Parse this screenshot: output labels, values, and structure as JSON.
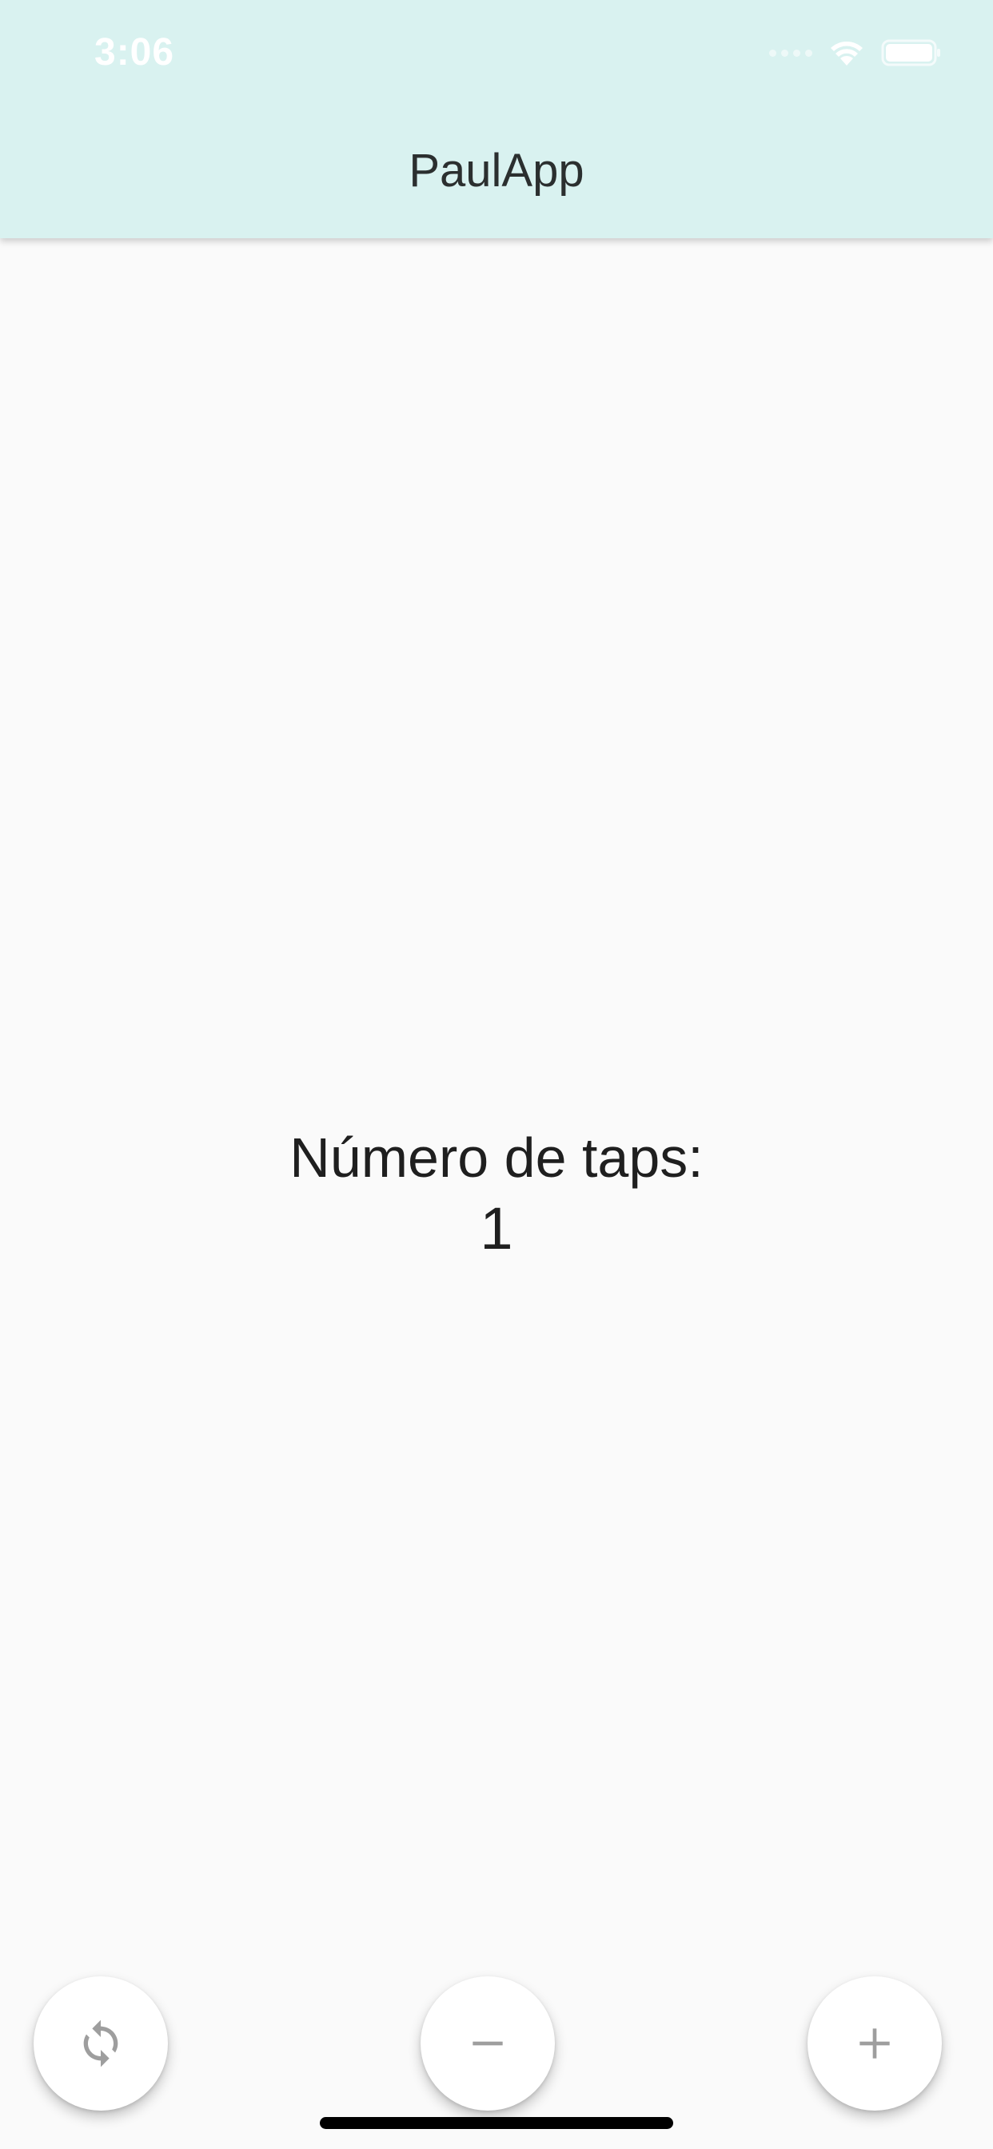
{
  "status_bar": {
    "time": "3:06",
    "icons": [
      "signal-icon",
      "wifi-icon",
      "battery-icon"
    ]
  },
  "app_bar": {
    "title": "PaulApp",
    "background": "#d9f2f0"
  },
  "main": {
    "label": "Número de taps:",
    "count": "1"
  },
  "actions": [
    {
      "name": "reset-button",
      "icon": "refresh-icon"
    },
    {
      "name": "decrement-button",
      "icon": "minus-icon"
    },
    {
      "name": "increment-button",
      "icon": "plus-icon"
    }
  ],
  "colors": {
    "icon": "#9e9e9e",
    "text": "#1f1f1f"
  }
}
